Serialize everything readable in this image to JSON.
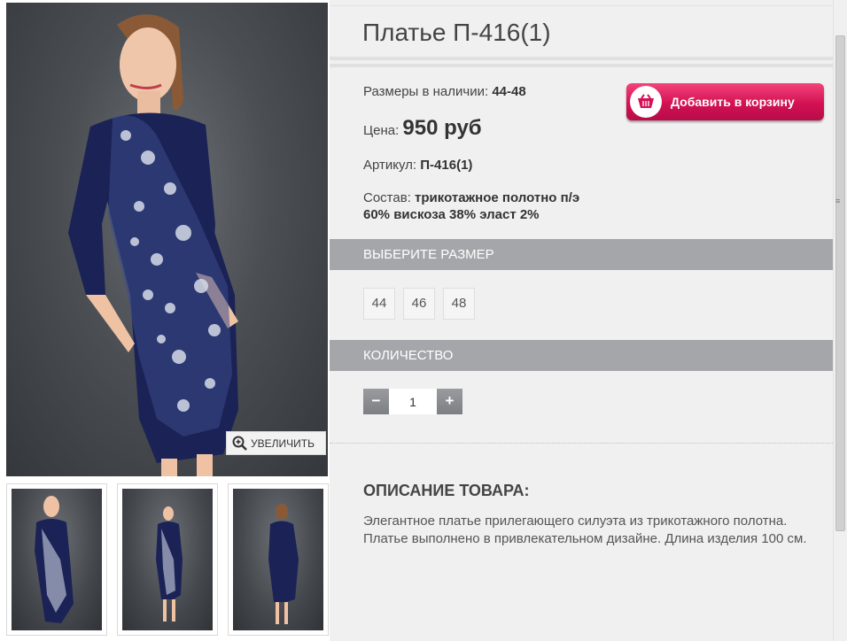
{
  "product": {
    "title": "Платье П-416(1)",
    "sizes_label": "Размеры в наличии:",
    "sizes_value": "44-48",
    "price_label": "Цена:",
    "price_value": "950 руб",
    "sku_label": "Артикул:",
    "sku_value": "П-416(1)",
    "composition_label": "Состав:",
    "composition_value_line1": "трикотажное полотно п/э",
    "composition_value_line2": "60% вискоза 38% эласт 2%"
  },
  "cart_button": {
    "label": "Добавить в корзину",
    "icon": "basket-icon",
    "color": "#d31154"
  },
  "zoom_button": {
    "label": "УВЕЛИЧИТЬ",
    "icon": "zoom-in-icon"
  },
  "size_section": {
    "title": "ВЫБЕРИТЕ РАЗМЕР",
    "options": [
      "44",
      "46",
      "48"
    ]
  },
  "quantity_section": {
    "title": "КОЛИЧЕСТВО",
    "value": "1",
    "minus": "−",
    "plus": "+"
  },
  "description": {
    "title": "ОПИСАНИЕ ТОВАРА:",
    "text": "Элегантное платье  прилегающего силуэта из трикотажного полотна. Платье выполнено в привлекательном дизайне. Длина изделия 100 см."
  },
  "colors": {
    "section_bar": "#a4a6a9",
    "panel_bg": "#f0f0f0",
    "dress_navy": "#1a2153"
  }
}
